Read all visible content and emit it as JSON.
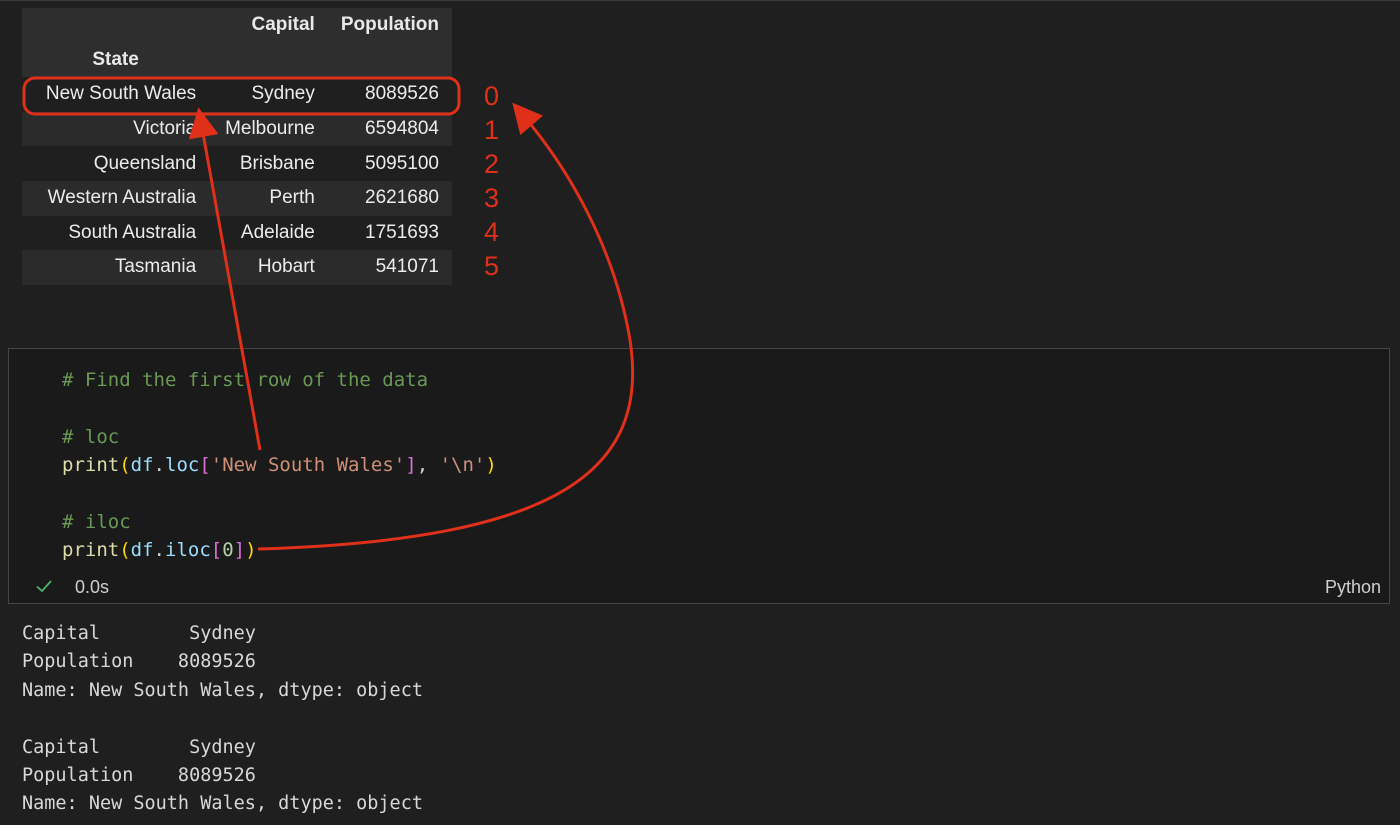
{
  "dataframe": {
    "columns": [
      "Capital",
      "Population"
    ],
    "index_name": "State",
    "rows": [
      {
        "state": "New South Wales",
        "capital": "Sydney",
        "population": "8089526"
      },
      {
        "state": "Victoria",
        "capital": "Melbourne",
        "population": "6594804"
      },
      {
        "state": "Queensland",
        "capital": "Brisbane",
        "population": "5095100"
      },
      {
        "state": "Western Australia",
        "capital": "Perth",
        "population": "2621680"
      },
      {
        "state": "South Australia",
        "capital": "Adelaide",
        "population": "1751693"
      },
      {
        "state": "Tasmania",
        "capital": "Hobart",
        "population": "541071"
      }
    ]
  },
  "row_indices": [
    "0",
    "1",
    "2",
    "3",
    "4",
    "5"
  ],
  "code": {
    "comment1": "# Find the first row of the data",
    "comment_loc": "# loc",
    "loc_func": "print",
    "loc_var": "df",
    "loc_attr": "loc",
    "loc_arg": "'New South Wales'",
    "loc_arg2": "'\\n'",
    "comment_iloc": "# iloc",
    "iloc_func": "print",
    "iloc_var": "df",
    "iloc_attr": "iloc",
    "iloc_arg": "0"
  },
  "status": {
    "time": "0.0s",
    "language": "Python"
  },
  "output": {
    "block1": [
      "Capital        Sydney",
      "Population    8089526",
      "Name: New South Wales, dtype: object"
    ],
    "block2": [
      "Capital        Sydney",
      "Population    8089526",
      "Name: New South Wales, dtype: object"
    ]
  },
  "annotation_color": "#e0301a"
}
